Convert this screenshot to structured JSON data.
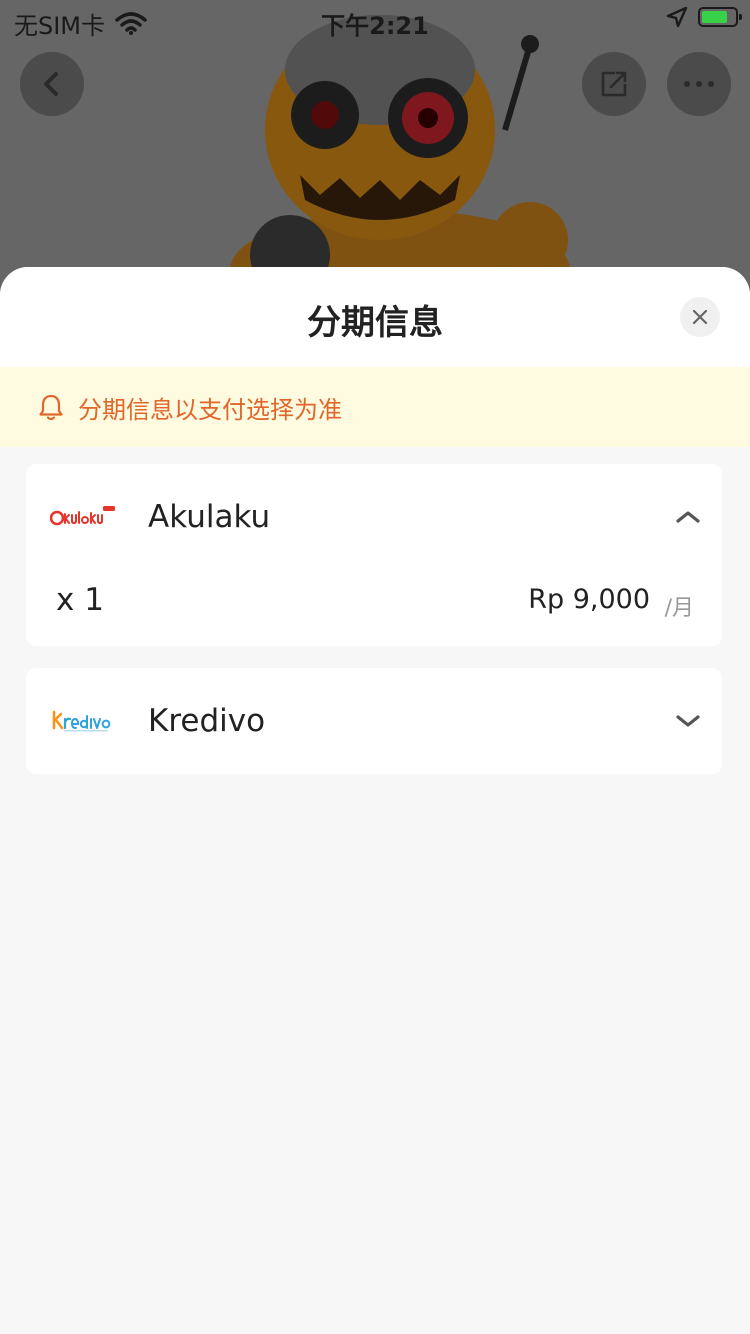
{
  "status_bar": {
    "carrier": "无SIM卡",
    "time": "下午2:21"
  },
  "sheet": {
    "title": "分期信息",
    "notice": "分期信息以支付选择为准"
  },
  "providers": [
    {
      "name": "Akulaku",
      "logo_text": "akulaku",
      "expanded": true,
      "plan": {
        "term": "x 1",
        "amount": "Rp 9,000",
        "unit": "/月"
      }
    },
    {
      "name": "Kredivo",
      "logo_text": "Kredivo",
      "expanded": false
    }
  ],
  "colors": {
    "notice_bg": "#fffbe0",
    "notice_text": "#e0662a",
    "akulaku_brand": "#e8352c",
    "kredivo_brand": "#2ea3dd",
    "kredivo_accent": "#f7941d"
  }
}
